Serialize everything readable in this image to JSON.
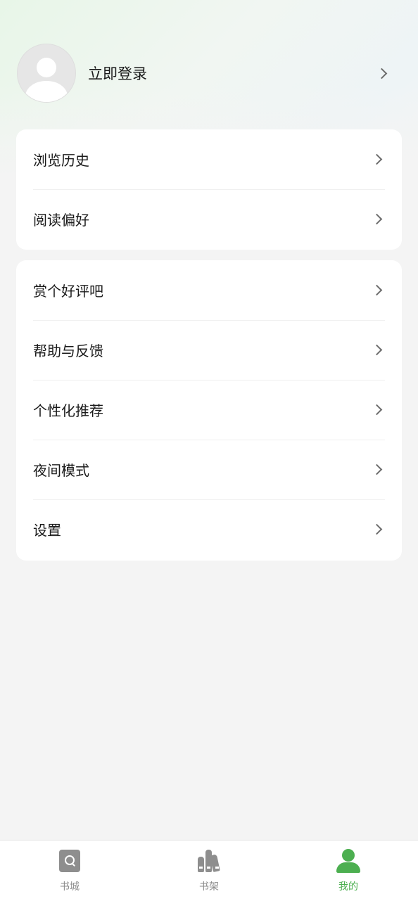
{
  "profile": {
    "login_label": "立即登录"
  },
  "menu_group_1": [
    {
      "label": "浏览历史"
    },
    {
      "label": "阅读偏好"
    }
  ],
  "menu_group_2": [
    {
      "label": "赏个好评吧"
    },
    {
      "label": "帮助与反馈"
    },
    {
      "label": "个性化推荐"
    },
    {
      "label": "夜间模式"
    },
    {
      "label": "设置"
    }
  ],
  "tabbar": {
    "tabs": [
      {
        "label": "书城",
        "icon": "bookstore-icon"
      },
      {
        "label": "书架",
        "icon": "bookshelf-icon"
      },
      {
        "label": "我的",
        "icon": "profile-icon"
      }
    ],
    "active_index": 2,
    "active_color": "#4caf50",
    "inactive_color": "#8a8a8a"
  }
}
